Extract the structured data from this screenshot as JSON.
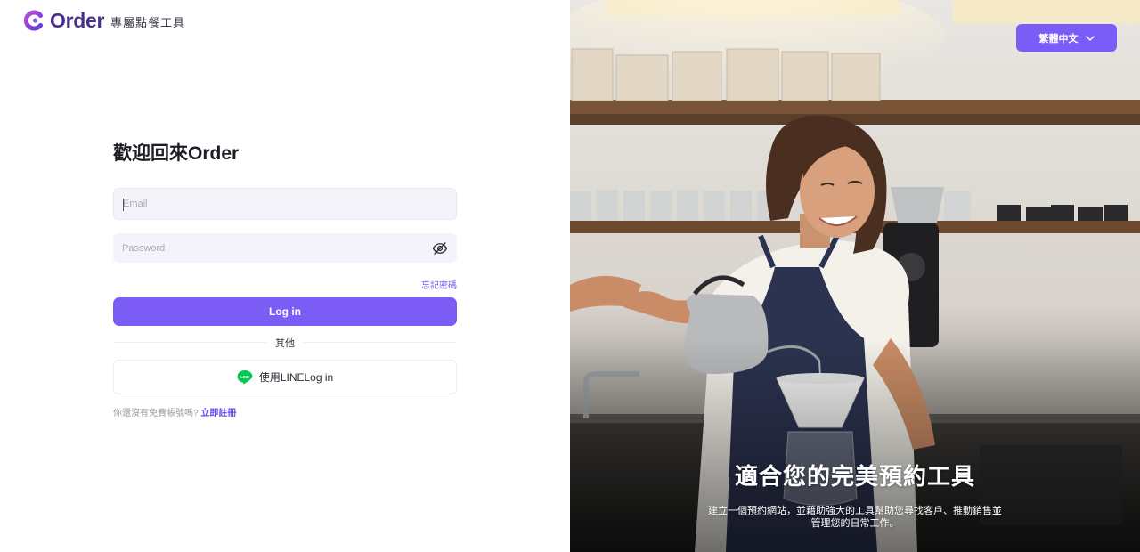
{
  "brand": {
    "name": "Order",
    "tagline": "專屬點餐工具",
    "logo_icon": "order-c-logo-icon",
    "brand_color": "#4a2f8f"
  },
  "login": {
    "title": "歡迎回來Order",
    "email_placeholder": "Email",
    "email_value": "",
    "password_placeholder": "Password",
    "password_value": "",
    "password_toggle_icon": "eye-off-icon",
    "forgot_label": "忘記密碼",
    "submit_label": "Log in",
    "divider_label": "其他",
    "line_login_label": "使用LINELog in",
    "line_icon": "line-app-icon",
    "line_icon_text": "LINE",
    "signup_prompt": "你還沒有免費帳號嗎?",
    "signup_link": "立即註冊"
  },
  "language": {
    "current": "繁體中文",
    "icon": "chevron-down-icon"
  },
  "hero": {
    "title": "適合您的完美預約工具",
    "subtitle": "建立一個預約網站，並藉助強大的工具幫助您尋找客戶、推動銷售並管理您的日常工作。"
  },
  "colors": {
    "accent": "#7b5cf4",
    "link": "#6a47ea",
    "field_bg": "#f4f3fa",
    "line_green": "#06c755"
  }
}
